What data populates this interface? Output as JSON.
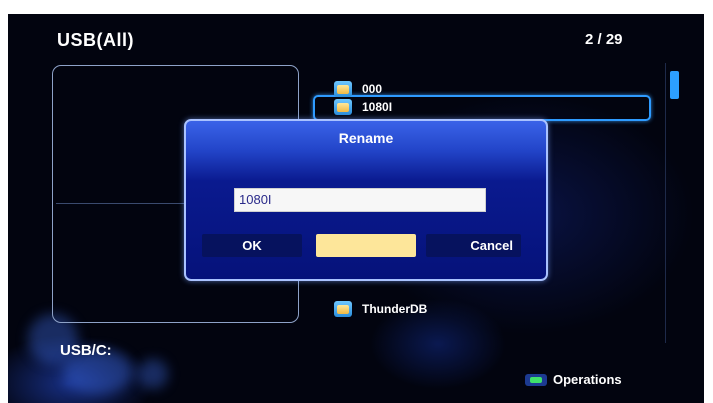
{
  "header": {
    "source": "USB(All)",
    "position": "2 / 29"
  },
  "files": [
    {
      "name": "000"
    },
    {
      "name": "1080I"
    },
    {
      "name": "ThunderDB"
    }
  ],
  "footer": {
    "path": "USB/C:",
    "operations_label": "Operations"
  },
  "rename_dialog": {
    "title": "Rename",
    "input_value": "1080I",
    "ok_label": "OK",
    "middle_label": "",
    "cancel_label": "Cancel"
  },
  "colors": {
    "selection_border": "#2e9bff",
    "dialog_blue": "#2244c8",
    "highlight_button": "#fde69a",
    "operations_key": "#3fe06b"
  },
  "icons": [
    "folder-icon",
    "green-key-icon"
  ]
}
